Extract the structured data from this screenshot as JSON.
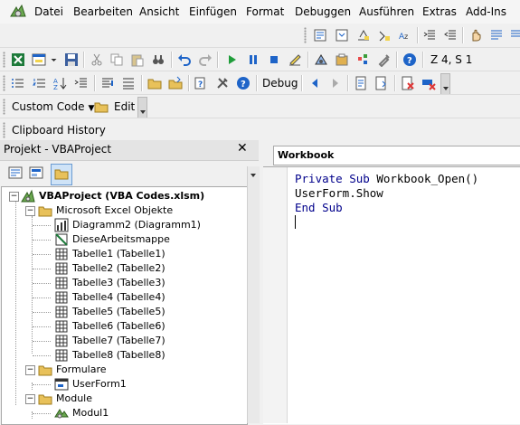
{
  "menu": {
    "items": [
      "Datei",
      "Bearbeiten",
      "Ansicht",
      "Einfügen",
      "Format",
      "Debuggen",
      "Ausführen",
      "Extras",
      "Add-Ins"
    ]
  },
  "toolbar": {
    "position_readout": "Z 4, S 1",
    "debug_label": "Debug",
    "custom_code_label": "Custom Code",
    "edit_label": "Edit",
    "clipboard_history_label": "Clipboard History"
  },
  "project_panel": {
    "title": "Projekt - VBAProject",
    "close_glyph": "✕",
    "tree": {
      "root": "VBAProject (VBA Codes.xlsm)",
      "folders": {
        "excel_objects": "Microsoft Excel Objekte",
        "forms": "Formulare",
        "modules": "Module"
      },
      "excel_items": [
        "Diagramm2 (Diagramm1)",
        "DieseArbeitsmappe",
        "Tabelle1 (Tabelle1)",
        "Tabelle2 (Tabelle2)",
        "Tabelle3 (Tabelle3)",
        "Tabelle4 (Tabelle4)",
        "Tabelle5 (Tabelle5)",
        "Tabelle6 (Tabelle6)",
        "Tabelle7 (Tabelle7)",
        "Tabelle8 (Tabelle8)"
      ],
      "form_items": [
        "UserForm1"
      ],
      "module_items": [
        "Modul1"
      ]
    }
  },
  "code_window": {
    "object_combo": "Workbook",
    "lines": [
      {
        "kw1": "Private Sub",
        "text": " Workbook_Open()"
      },
      {
        "text": "UserForm.Show"
      },
      {
        "kw1": "End Sub"
      }
    ]
  },
  "colors": {
    "keyword": "#00008b",
    "accent_blue": "#1e64c8",
    "folder_yellow": "#e8c15a"
  }
}
